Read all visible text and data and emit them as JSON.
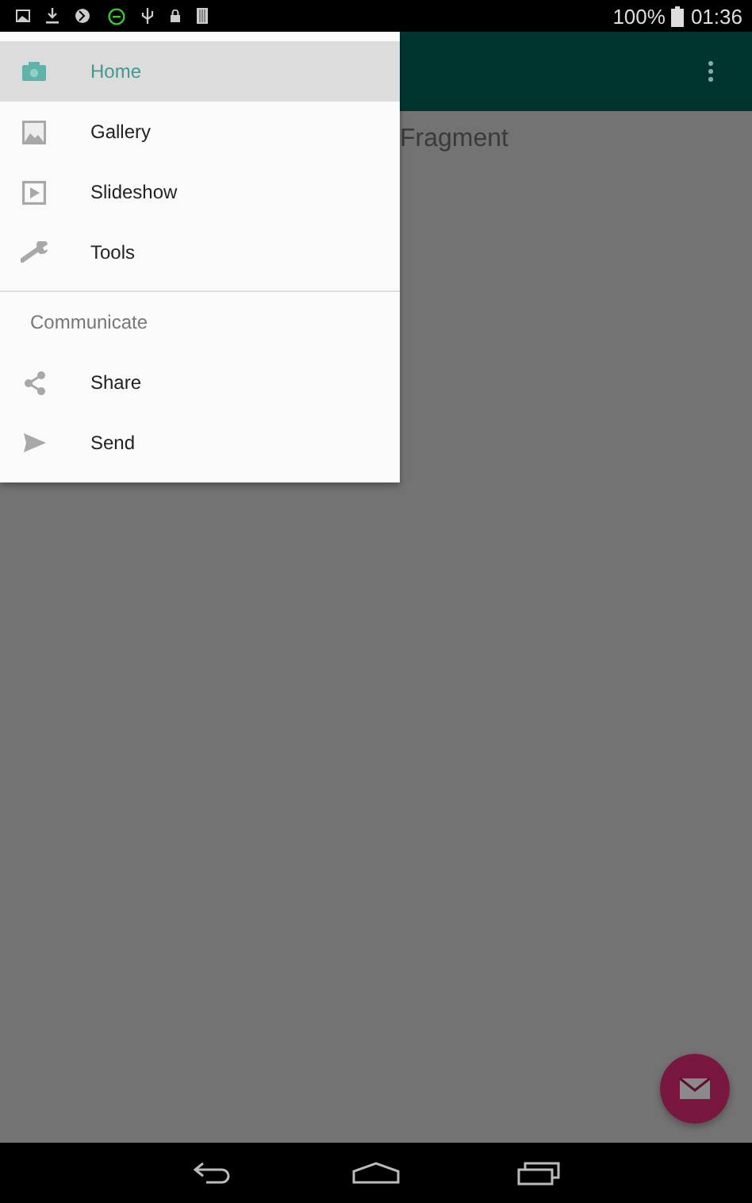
{
  "status_bar": {
    "battery": "100%",
    "time": "01:36"
  },
  "content": {
    "text": "Fragment"
  },
  "drawer": {
    "sections": [
      {
        "items": [
          {
            "label": "Home",
            "kind": "camera",
            "selected": true
          },
          {
            "label": "Gallery",
            "kind": "gallery",
            "selected": false
          },
          {
            "label": "Slideshow",
            "kind": "slideshow",
            "selected": false
          },
          {
            "label": "Tools",
            "kind": "tools",
            "selected": false
          }
        ]
      },
      {
        "header": "Communicate",
        "items": [
          {
            "label": "Share",
            "kind": "share",
            "selected": false
          },
          {
            "label": "Send",
            "kind": "send",
            "selected": false
          }
        ]
      }
    ]
  }
}
